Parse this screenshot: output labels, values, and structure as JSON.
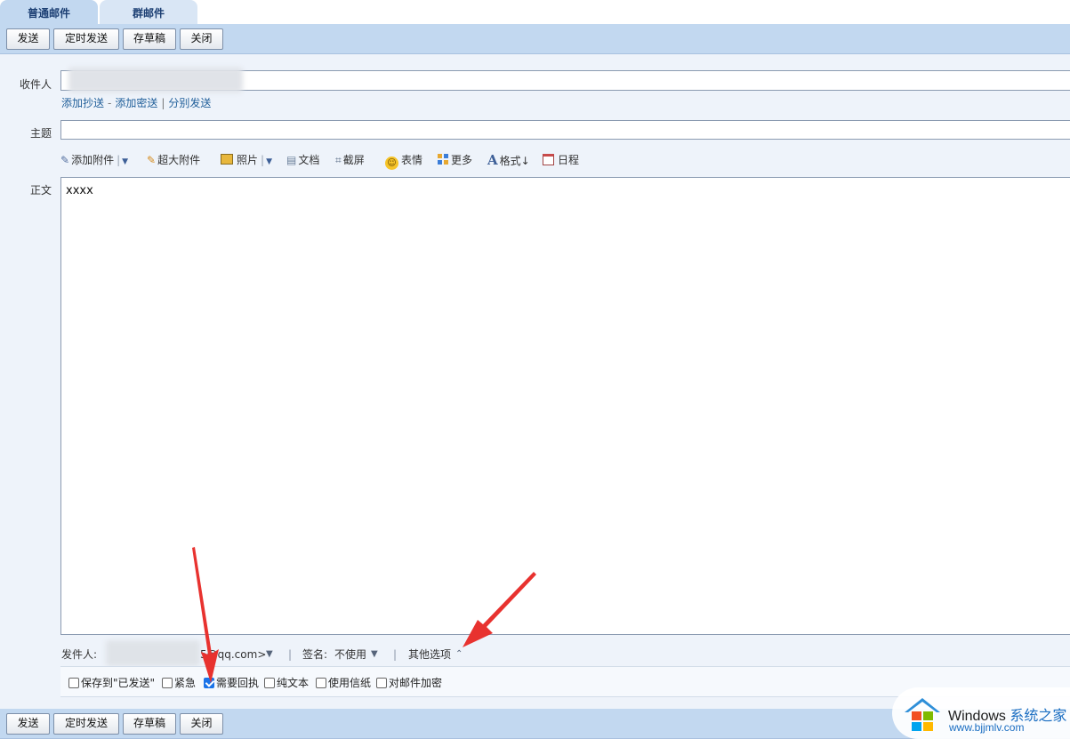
{
  "tabs": [
    {
      "label": "普通邮件",
      "active": true
    },
    {
      "label": "群邮件",
      "active": false
    }
  ],
  "toolbar": {
    "send": "发送",
    "timed_send": "定时发送",
    "save_draft": "存草稿",
    "close": "关闭"
  },
  "compose": {
    "to_label": "收件人",
    "to_value": "",
    "add_cc": "添加抄送",
    "dash": "-",
    "add_bcc": "添加密送",
    "bar": "|",
    "split_send": "分别发送",
    "subject_label": "主题",
    "subject_value": "",
    "body_label": "正文",
    "body_text": "xxxx"
  },
  "editor_tools": {
    "attach": "添加附件",
    "large_attach": "超大附件",
    "photo": "照片",
    "document": "文档",
    "screenshot": "截屏",
    "emoji": "表情",
    "more": "更多",
    "format": "格式↓",
    "schedule": "日程"
  },
  "sender": {
    "label": "发件人:",
    "email_visible": "5@qq.com>",
    "signature_label": "签名:",
    "signature_value": "不使用",
    "other_options": "其他选项",
    "sep": "|"
  },
  "options": [
    {
      "label": "保存到\"已发送\"",
      "checked": false
    },
    {
      "label": "紧急",
      "checked": false
    },
    {
      "label": "需要回执",
      "checked": true
    },
    {
      "label": "纯文本",
      "checked": false
    },
    {
      "label": "使用信纸",
      "checked": false
    },
    {
      "label": "对邮件加密",
      "checked": false
    }
  ],
  "watermark": {
    "brand": "Windows",
    "brand_cn": "系统之家",
    "url": "www.bjjmlv.com"
  },
  "colors": {
    "toolbar_bg": "#c2d8f0",
    "page_bg": "#eef3fa",
    "link": "#1f5e99",
    "arrow": "#e8322f",
    "checkbox_on": "#1a73e8"
  }
}
